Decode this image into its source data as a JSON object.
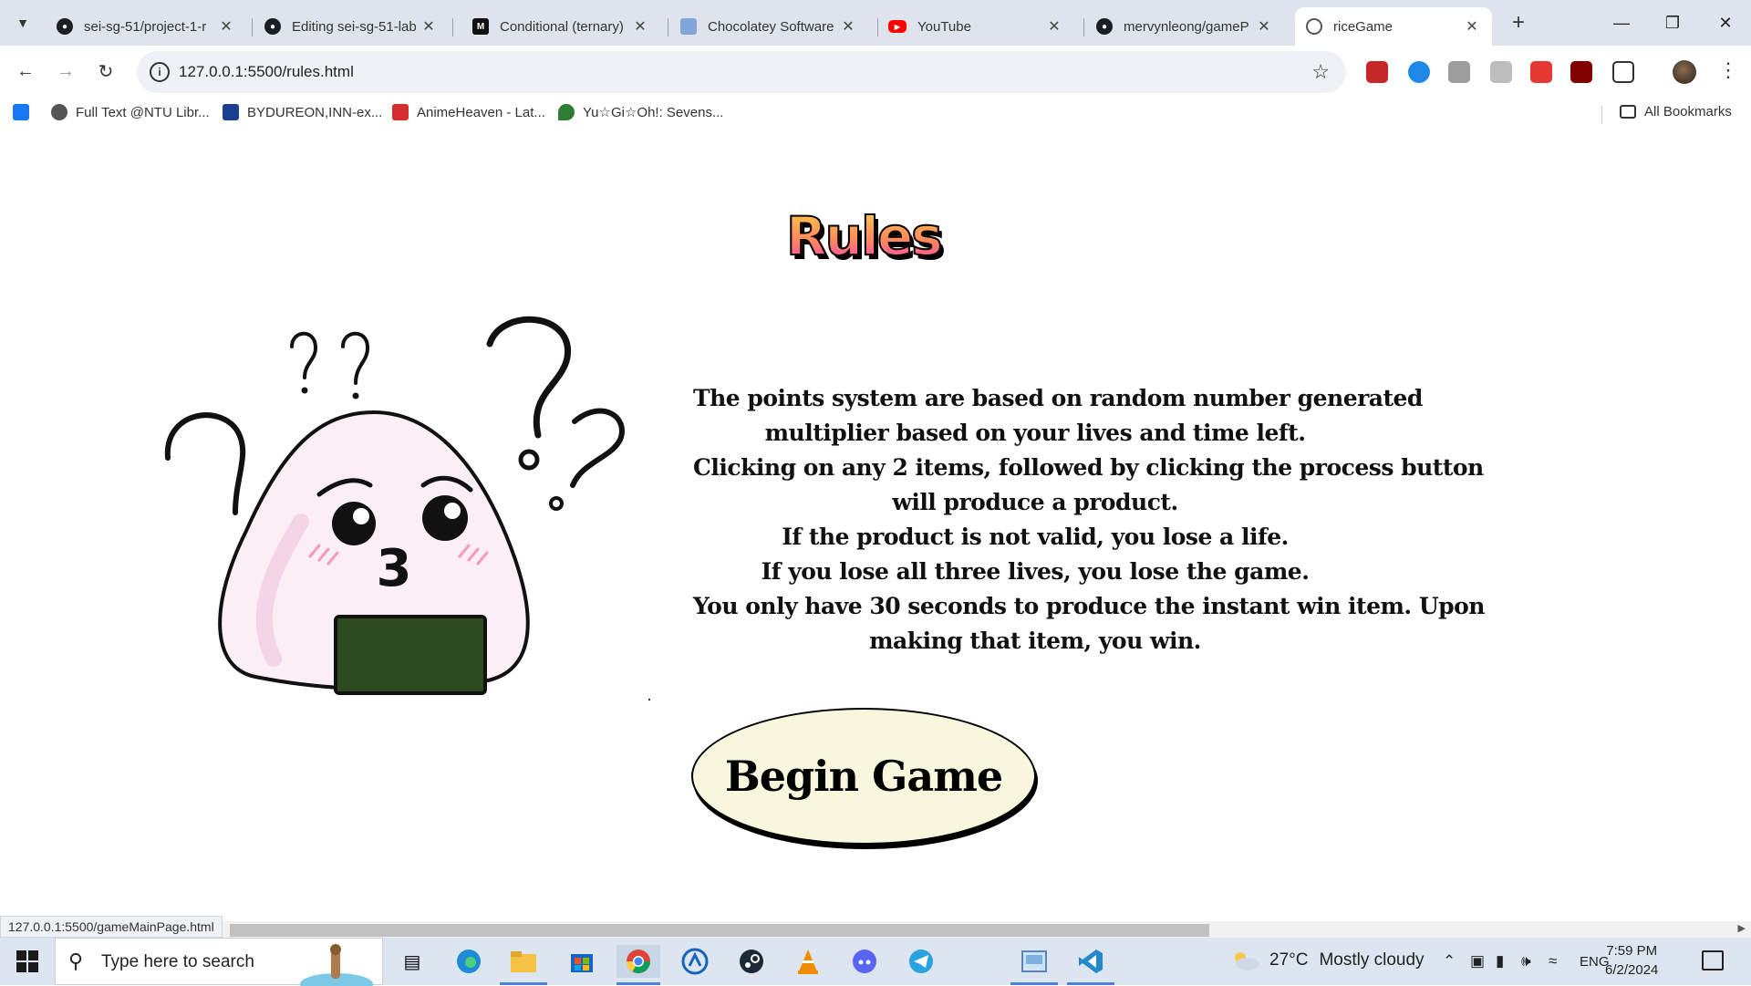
{
  "browser": {
    "tabs": [
      {
        "title": "sei-sg-51/project-1-r",
        "icon": "github-icon",
        "active": false
      },
      {
        "title": "Editing sei-sg-51-lab",
        "icon": "github-icon",
        "active": false
      },
      {
        "title": "Conditional (ternary)",
        "icon": "mdn-icon",
        "active": false
      },
      {
        "title": "Chocolatey Software",
        "icon": "chocolatey-icon",
        "active": false
      },
      {
        "title": "YouTube",
        "icon": "youtube-icon",
        "active": false
      },
      {
        "title": "mervynleong/gameP",
        "icon": "github-icon",
        "active": false
      },
      {
        "title": "riceGame",
        "icon": "globe-icon",
        "active": true
      }
    ],
    "url": "127.0.0.1:5500/rules.html",
    "bookmarks": [
      {
        "label": "",
        "icon": "facebook-icon"
      },
      {
        "label": "Full Text @NTU Libr...",
        "icon": "library-icon"
      },
      {
        "label": "BYDUREON,INN-ex...",
        "icon": "eu-flag-icon"
      },
      {
        "label": "AnimeHeaven - Lat...",
        "icon": "animeheaven-icon"
      },
      {
        "label": "Yu☆Gi☆Oh!: Sevens...",
        "icon": "yugioh-icon"
      }
    ],
    "all_bookmarks_label": "All Bookmarks",
    "status_url": "127.0.0.1:5500/gameMainPage.html"
  },
  "page": {
    "title": "Rules",
    "rules_lines": [
      "The points system are based on random number generated",
      "multiplier based on your lives and time left.",
      "Clicking on any 2 items, followed by clicking the process button",
      "will produce a product.",
      "If the product is not valid, you lose a life.",
      "If you lose all three lives, you lose the game.",
      "You only have 30 seconds to produce the instant win item. Upon",
      "making that item, you win."
    ],
    "begin_button": "Begin Game",
    "illustration": "confused-rice-ball-illustration"
  },
  "taskbar": {
    "search_placeholder": "Type here to search",
    "weather_temp": "27°C",
    "weather_desc": "Mostly cloudy",
    "language": "ENG",
    "time": "7:59 PM",
    "date": "6/2/2024",
    "pinned": [
      "task-view-icon",
      "edge-icon",
      "file-explorer-icon",
      "store-icon",
      "chrome-icon",
      "app-icon",
      "steam-icon",
      "vlc-icon",
      "discord-icon",
      "telegram-icon",
      "image-viewer-icon",
      "vscode-icon"
    ]
  },
  "colors": {
    "title_gradient_top": "#ffd44a",
    "title_gradient_bottom": "#ff3dbb",
    "button_fill": "#f8f6dd",
    "nori": "#2d4a1e"
  }
}
